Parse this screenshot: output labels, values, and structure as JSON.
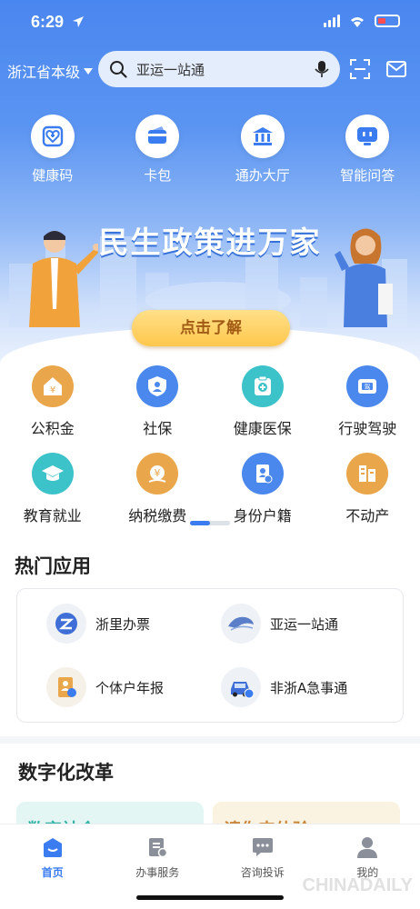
{
  "status": {
    "time": "6:29"
  },
  "header": {
    "region": "浙江省本级",
    "search_text": "亚运一站通"
  },
  "quick_actions": [
    {
      "label": "健康码",
      "icon": "health-code-icon"
    },
    {
      "label": "卡包",
      "icon": "card-wallet-icon"
    },
    {
      "label": "通办大厅",
      "icon": "service-hall-icon"
    },
    {
      "label": "智能问答",
      "icon": "ai-chat-icon"
    }
  ],
  "banner": {
    "title": "民生政策进万家",
    "cta": "点击了解"
  },
  "services": [
    {
      "label": "公积金",
      "icon": "housing-fund-icon",
      "color": "#e9a64b"
    },
    {
      "label": "社保",
      "icon": "social-security-icon",
      "color": "#4a88ee"
    },
    {
      "label": "健康医保",
      "icon": "medical-insurance-icon",
      "color": "#3cc2c9"
    },
    {
      "label": "行驶驾驶",
      "icon": "driving-license-icon",
      "color": "#4a88ee"
    },
    {
      "label": "教育就业",
      "icon": "education-icon",
      "color": "#3cc2c9"
    },
    {
      "label": "纳税缴费",
      "icon": "tax-payment-icon",
      "color": "#e9a64b"
    },
    {
      "label": "身份户籍",
      "icon": "identity-icon",
      "color": "#4a88ee"
    },
    {
      "label": "不动产",
      "icon": "real-estate-icon",
      "color": "#e9a64b"
    }
  ],
  "hot_apps": {
    "title": "热门应用",
    "items": [
      {
        "label": "浙里办票",
        "icon": "zheli-ticket-icon"
      },
      {
        "label": "亚运一站通",
        "icon": "asian-games-icon"
      },
      {
        "label": "个体户年报",
        "icon": "annual-report-icon"
      },
      {
        "label": "非浙A急事通",
        "icon": "car-urgent-icon"
      }
    ]
  },
  "digital_reform": {
    "title": "数字化改革",
    "cards": [
      "数字社会",
      "请你来体验"
    ]
  },
  "tabs": [
    {
      "label": "首页",
      "icon": "home-icon",
      "active": true
    },
    {
      "label": "办事服务",
      "icon": "service-list-icon",
      "active": false
    },
    {
      "label": "咨询投诉",
      "icon": "message-icon",
      "active": false
    },
    {
      "label": "我的",
      "icon": "profile-icon",
      "active": false
    }
  ],
  "watermark": "CHINADAILY"
}
